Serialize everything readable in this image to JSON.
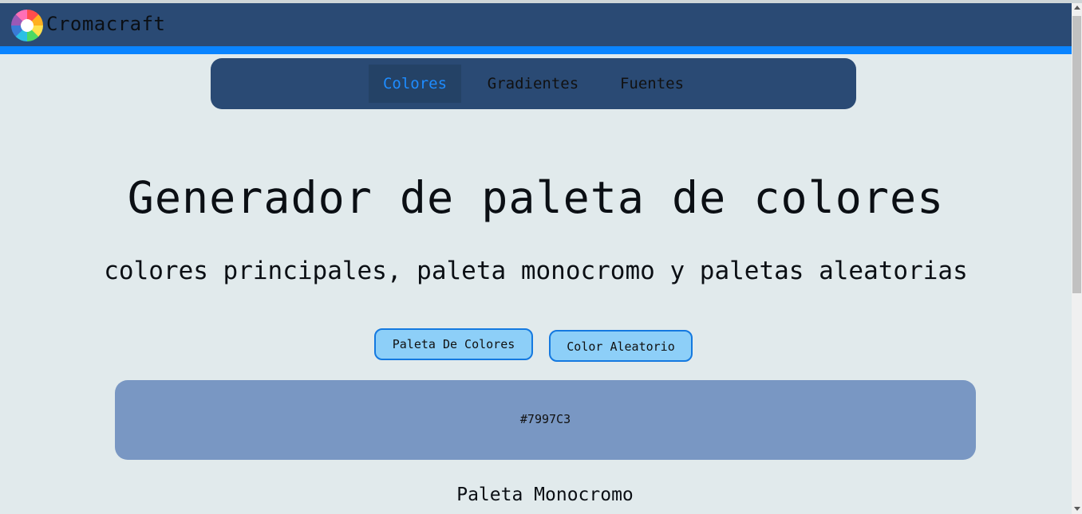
{
  "app": {
    "brand": "Cromacraft",
    "logo_icon": "color-wheel-icon"
  },
  "nav": {
    "items": [
      {
        "label": "Colores",
        "active": true
      },
      {
        "label": "Gradientes",
        "active": false
      },
      {
        "label": "Fuentes",
        "active": false
      }
    ]
  },
  "main": {
    "title": "Generador de paleta de colores",
    "subtitle": "colores principales, paleta monocromo y paletas aleatorias",
    "buttons": {
      "palette": "Paleta De Colores",
      "random": "Color Aleatorio"
    },
    "current_color": {
      "hex": "#7997C3"
    },
    "monochrome_title": "Paleta Monocromo"
  },
  "colors": {
    "header_bg": "#2a4a74",
    "accent": "#0a84ff",
    "page_bg": "#e1eaec",
    "button_bg": "#8dcff8"
  }
}
